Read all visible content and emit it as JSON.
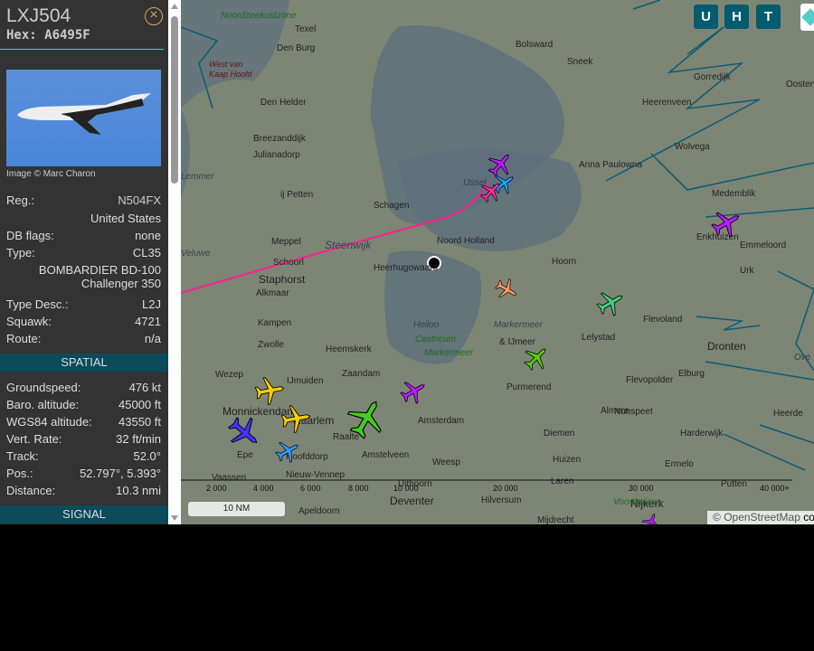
{
  "aircraft": {
    "callsign": "LXJ504",
    "hex": "Hex: A6495F",
    "image_credit": "Image © Marc Charon",
    "fields": [
      {
        "label": "Reg.:",
        "value": "N504FX"
      },
      {
        "label": "",
        "value": "United States"
      },
      {
        "label": "DB flags:",
        "value": "none"
      },
      {
        "label": "Type:",
        "value": "CL35"
      },
      {
        "label": "",
        "value": "BOMBARDIER BD-100 Challenger 350"
      },
      {
        "label": "Type Desc.:",
        "value": "L2J"
      },
      {
        "label": "Squawk:",
        "value": "4721"
      },
      {
        "label": "Route:",
        "value": "n/a"
      }
    ],
    "spatial_header": "SPATIAL",
    "spatial": [
      {
        "label": "Groundspeed:",
        "value": "476 kt"
      },
      {
        "label": "Baro. altitude:",
        "value": "45000 ft"
      },
      {
        "label": "WGS84 altitude:",
        "value": "43550 ft"
      },
      {
        "label": "Vert. Rate:",
        "value": "32 ft/min"
      },
      {
        "label": "Track:",
        "value": "52.0°"
      },
      {
        "label": "Pos.:",
        "value": "52.797°, 5.393°"
      },
      {
        "label": "Distance:",
        "value": "10.3 nmi"
      }
    ],
    "signal_header": "SIGNAL"
  },
  "map": {
    "buttons": [
      "U",
      "H",
      "T"
    ],
    "scale": "10 NM",
    "attribution_prefix": "© ",
    "attribution": "OpenStreetMap",
    "attribution_suffix": " co",
    "altitude_ticks": [
      "2 000",
      "4 000",
      "6 000",
      "8 000",
      "10 000",
      "20 000",
      "30 000",
      "40 000+"
    ],
    "places": [
      "Noordzeekustzone",
      "Texel",
      "Den Burg",
      "Bolsward",
      "Sneek",
      "Gorredijk",
      "Oosterwolde",
      "Heerenveen",
      "Wolvega",
      "West van",
      "Kaap Hoofd",
      "Den Helder",
      "Breezanddijk",
      "Julianadorp",
      "Anna Paulowna",
      "Lemmer",
      "ij Petten",
      "Schagen",
      "Medemblik",
      "Steenwijk",
      "Noord Holland",
      "Enkhuizen",
      "Emmeloord",
      "Meppel",
      "Schoorl",
      "Heerhugowaard",
      "Hoorn",
      "Urk",
      "Staphorst",
      "Alkmaar",
      "Heiloo",
      "Markermeer",
      "Flevoland",
      "Kampen",
      "Castricum",
      "Markermeer",
      "& IJmeer",
      "Lelystad",
      "Dronten",
      "Zwolle",
      "Heemskerk",
      "Purmerend",
      "Flevopolder",
      "Elburg",
      "Wezep",
      "IJmuiden",
      "Zaandam",
      "Monnickendam",
      "Haarlem",
      "Amsterdam",
      "Almere",
      "Nunspeet",
      "Heerde",
      "Raalte",
      "Diemen",
      "Harderwijk",
      "Epe",
      "Hoofddorp",
      "Amstelveen",
      "Weesp",
      "Huizen",
      "Ermelo",
      "Vaassen",
      "Nieuw-Vennep",
      "Uithoorn",
      "Laren",
      "Putten",
      "Deventer",
      "Hilversum",
      "Nijkerk",
      "Apeldoorn",
      "Mijdrecht",
      "Voorthuizen",
      "Veluwe",
      "IJssel",
      "Ove"
    ],
    "track_color": "#ff1f8f",
    "aircraft_colors": [
      "#b71cff",
      "#1fa0ff",
      "#ff2da0",
      "#ff9966",
      "#44cc77",
      "#55cc11",
      "#b71cff",
      "#ffcc00",
      "#ffcc00",
      "#4433ff",
      "#3399ff",
      "#44cc22",
      "#b71cff",
      "#b71cff"
    ]
  }
}
